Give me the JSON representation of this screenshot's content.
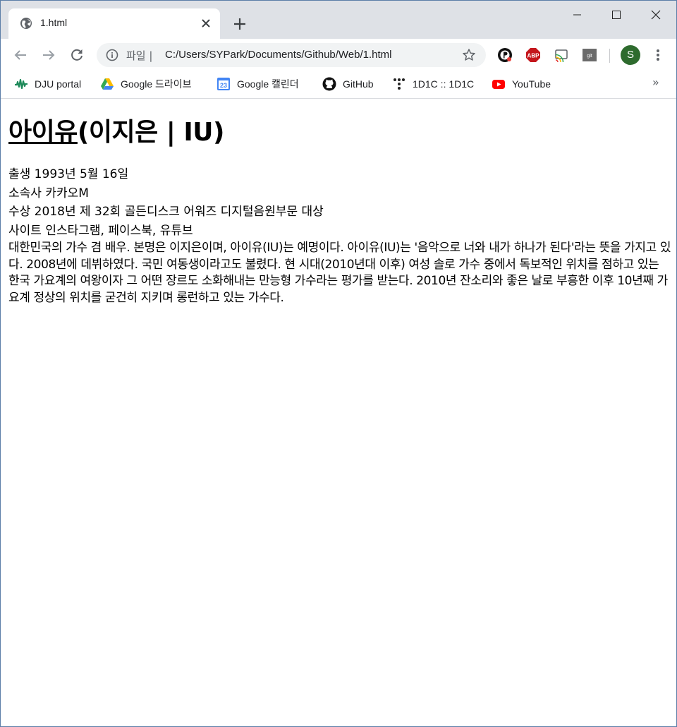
{
  "browser": {
    "tab_title": "1.html",
    "omnibox_scheme": "파일 |",
    "url": "C:/Users/SYPark/Documents/Github/Web/1.html",
    "profile_initial": "S",
    "extensions": [
      "p-icon",
      "abp-icon",
      "cast-icon",
      "git-icon"
    ],
    "ext_labels": {
      "abp": "ABP",
      "git": "git"
    }
  },
  "bookmarks": [
    {
      "label": "DJU portal",
      "icon": "dju-icon"
    },
    {
      "label": "Google 드라이브",
      "icon": "google-drive-icon"
    },
    {
      "label": "Google 캘린더",
      "icon": "google-calendar-icon",
      "icon_text": "23"
    },
    {
      "label": "GitHub",
      "icon": "github-icon"
    },
    {
      "label": "1D1C :: 1D1C",
      "icon": "dots-icon"
    },
    {
      "label": "YouTube",
      "icon": "youtube-icon"
    }
  ],
  "bookmarks_more": "»",
  "page": {
    "title_link": "아이유",
    "title_rest": "(이지은 | IU)",
    "lines": [
      "출생 1993년 5월 16일",
      "소속사 카카오M",
      "수상 2018년 제 32회 골든디스크 어워즈 디지털음원부문 대상",
      "사이트 인스타그램, 페이스북, 유튜브"
    ],
    "bio": "대한민국의 가수 겸 배우. 본명은 이지은이며, 아이유(IU)는 예명이다. 아이유(IU)는 '음악으로 너와 내가 하나가 된다'라는 뜻을 가지고 있다. 2008년에 데뷔하였다. 국민 여동생이라고도 불렸다. 현 시대(2010년대 이후) 여성 솔로 가수 중에서 독보적인 위치를 점하고 있는 한국 가요계의 여왕이자 그 어떤 장르도 소화해내는 만능형 가수라는 평가를 받는다. 2010년 잔소리와 좋은 날로 부흥한 이후 10년째 가요계 정상의 위치를 굳건히 지키며 롱런하고 있는 가수다."
  },
  "colors": {
    "tabstrip": "#dee1e6",
    "omnibox": "#f1f3f4",
    "profile": "#2e6b2e",
    "abp": "#c4161c",
    "youtube": "#ff0000"
  }
}
